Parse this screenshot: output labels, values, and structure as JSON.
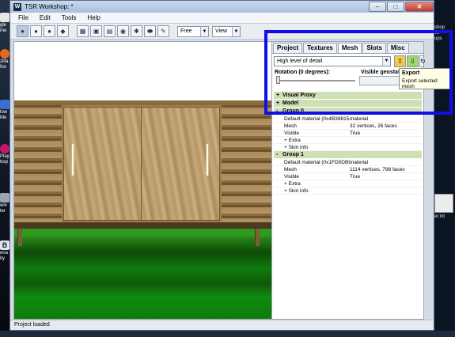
{
  "window": {
    "title": "TSR Workshop: *",
    "controls": [
      "–",
      "□",
      "✕"
    ]
  },
  "menu": [
    "File",
    "Edit",
    "Tools",
    "Help"
  ],
  "toolbar": {
    "camera_select": "Free",
    "view_select": "View"
  },
  "panel": {
    "tabs": [
      "Project",
      "Textures",
      "Mesh",
      "Slots",
      "Misc"
    ],
    "active_tab": "Mesh",
    "lod_select": "High level of detail",
    "rotation_label": "Rotation (0 degrees):",
    "visible_label": "Visible geostate",
    "tree": {
      "visual_proxy": "Visual Proxy",
      "model": "Model",
      "group0": {
        "title": "Group 0",
        "rows": [
          {
            "k": "Default material (0x4B398151)",
            "v": "material"
          },
          {
            "k": "Mesh",
            "v": "32 vertices, 26 faces"
          },
          {
            "k": "Visible",
            "v": "True"
          }
        ],
        "extra": "Extra",
        "skin": "Skin info"
      },
      "group1": {
        "title": "Group 1",
        "rows": [
          {
            "k": "Default material (0x1FD0DB96)",
            "v": "material"
          },
          {
            "k": "Mesh",
            "v": "1114 vertices, 798 faces"
          },
          {
            "k": "Visible",
            "v": "True"
          }
        ],
        "extra": "Extra",
        "skin": "Skin info"
      }
    }
  },
  "tooltip": {
    "title": "Export",
    "text": "Export selected mesh"
  },
  "status": "Project loaded",
  "desktop": {
    "left_icons": [
      "gle",
      "me",
      "zilla",
      "fox",
      "low",
      "Me",
      "Play",
      "ttop",
      "win",
      "ter",
      "B",
      "ena",
      "ity"
    ],
    "right_texts": [
      "shop",
      "lle",
      "ups",
      "er.txt"
    ]
  },
  "colors": {
    "highlight": "#1010e6",
    "group_header": "#cfe0b6"
  }
}
